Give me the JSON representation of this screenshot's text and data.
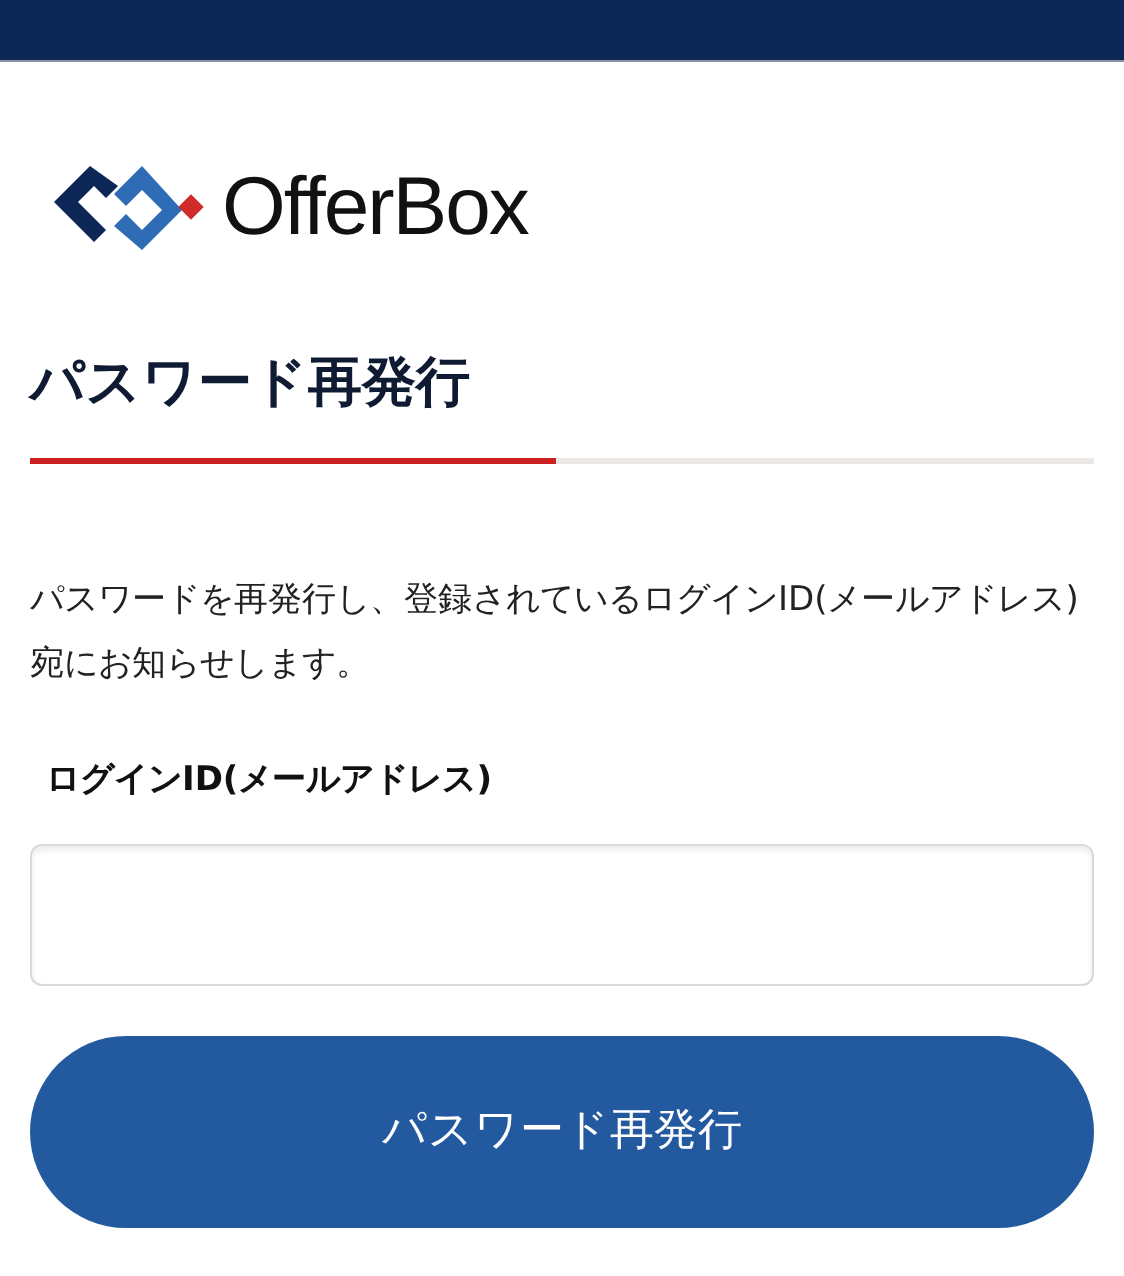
{
  "logo": {
    "text": "OfferBox"
  },
  "heading": "パスワード再発行",
  "description": "パスワードを再発行し、登録されているログインID(メールアドレス)宛にお知らせします。",
  "login_field": {
    "label": "ログインID(メールアドレス)"
  },
  "submit_button": {
    "label": "パスワード再発行"
  }
}
